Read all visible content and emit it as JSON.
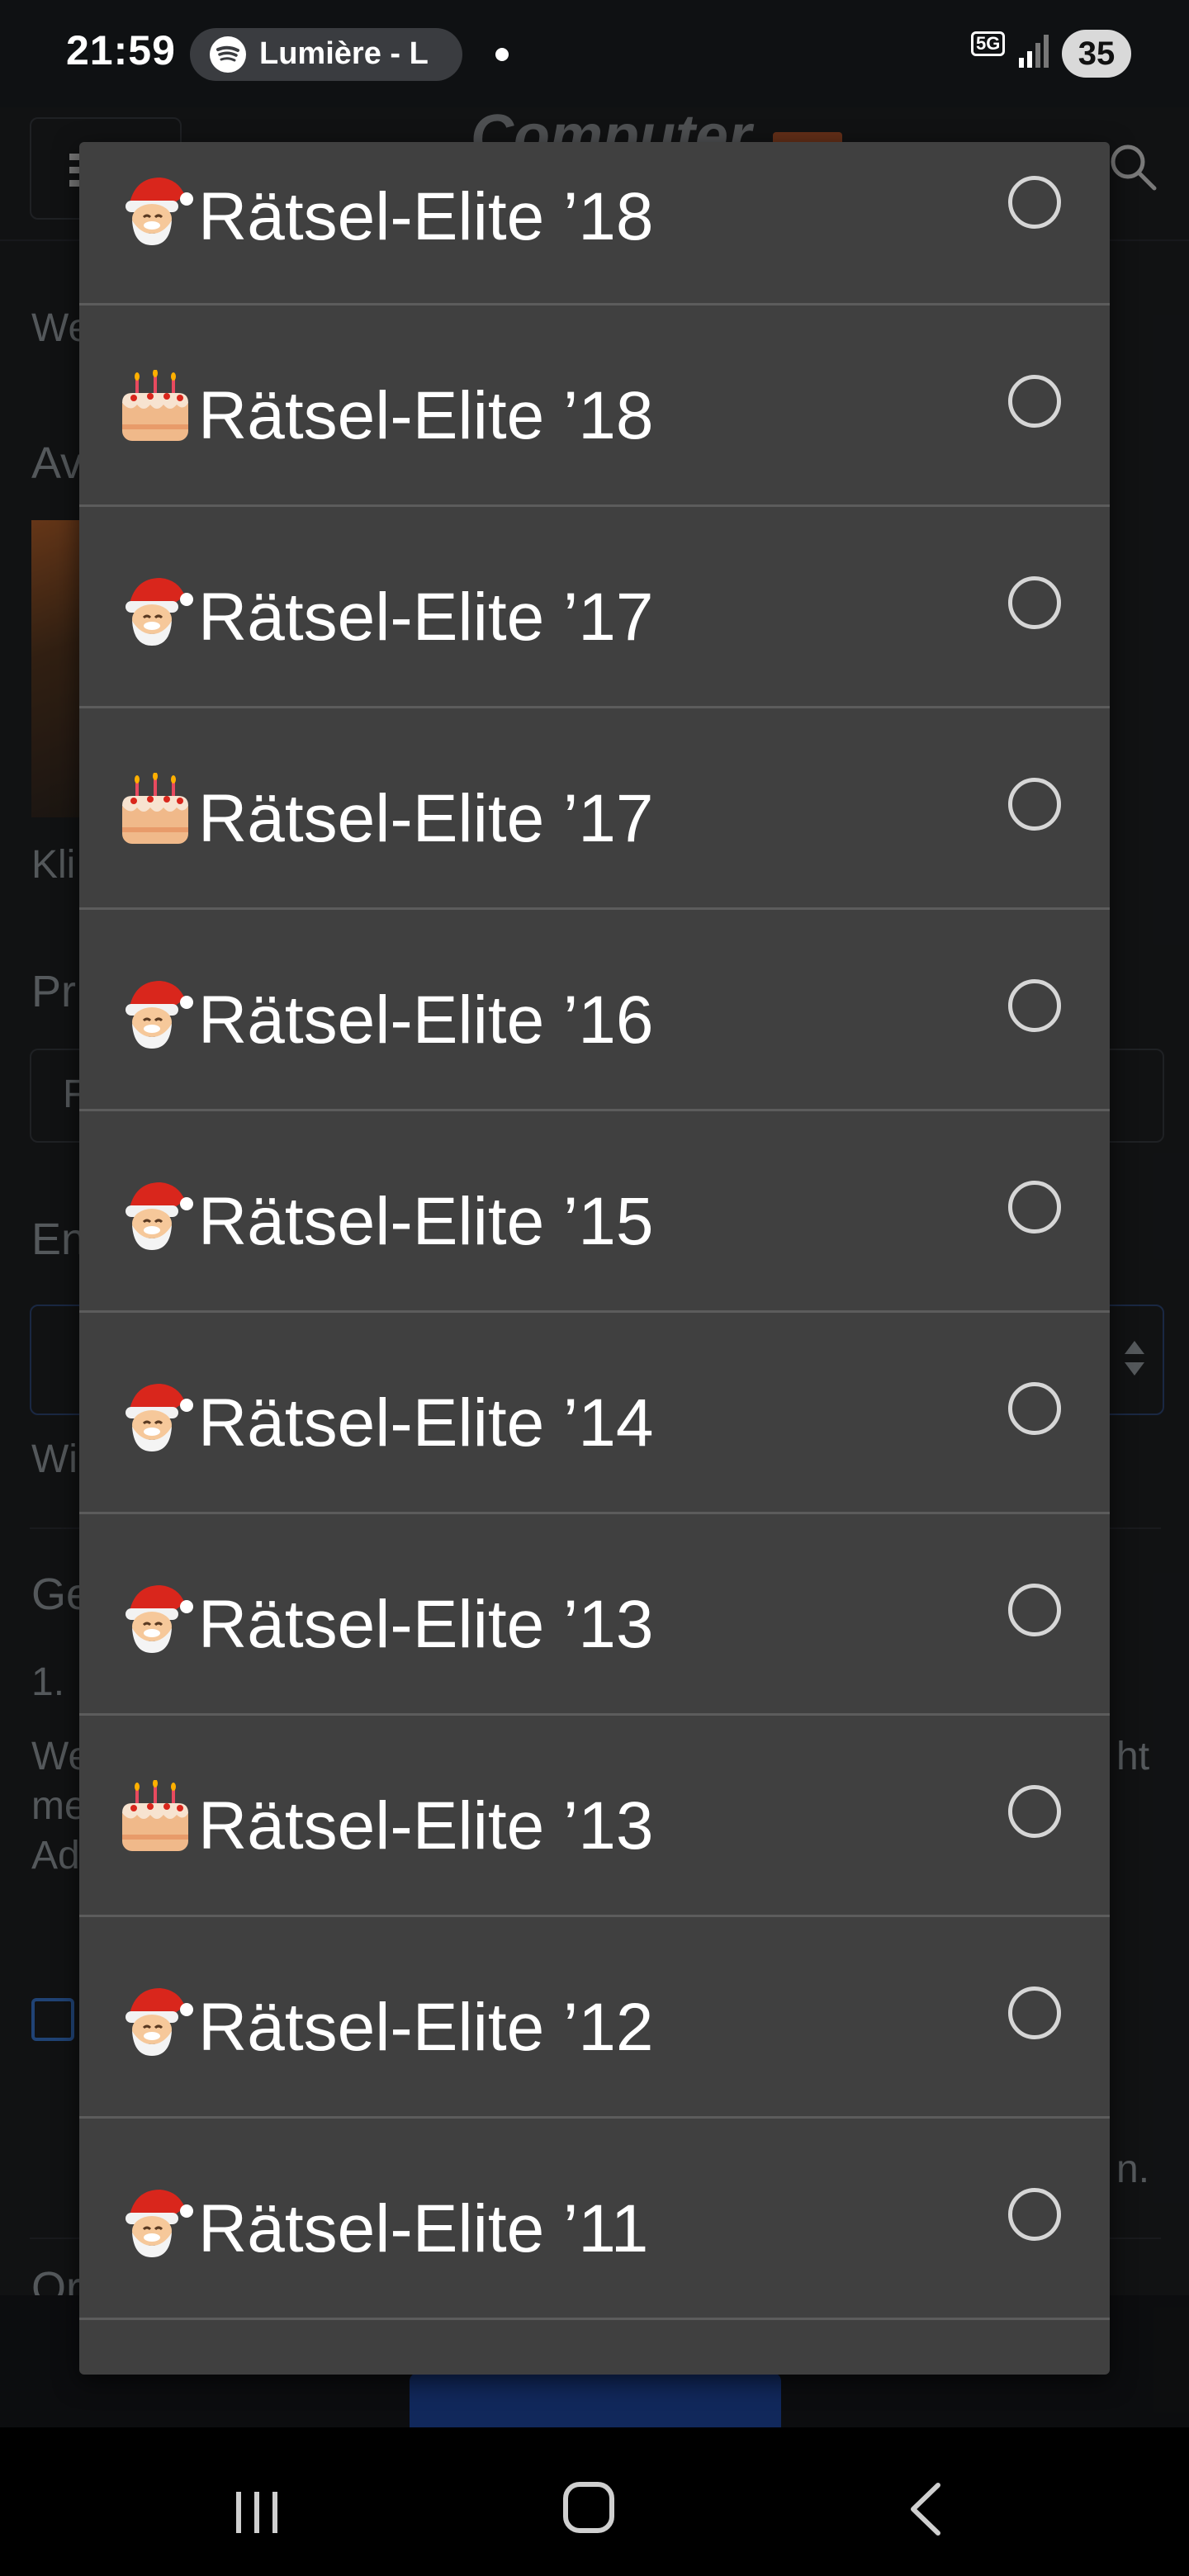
{
  "status_bar": {
    "time": "21:59",
    "media_title": "Lumière - L",
    "network": "5G",
    "battery": "35"
  },
  "page": {
    "logo_text": "Computer",
    "bg_snippets": [
      "We",
      "Av",
      "Kli",
      "Pr",
      "F",
      "En",
      "Wi",
      "Ge",
      "1.",
      "We",
      "me",
      "Ad",
      "ht",
      "n.",
      "Or"
    ]
  },
  "dialog": {
    "options": [
      {
        "icon": "santa-icon",
        "label": "Rätsel-Elite ’18",
        "selected": false
      },
      {
        "icon": "birthday-cake-icon",
        "label": "Rätsel-Elite ’18",
        "selected": false
      },
      {
        "icon": "santa-icon",
        "label": "Rätsel-Elite ’17",
        "selected": false
      },
      {
        "icon": "birthday-cake-icon",
        "label": "Rätsel-Elite ’17",
        "selected": false
      },
      {
        "icon": "santa-icon",
        "label": "Rätsel-Elite ’16",
        "selected": false
      },
      {
        "icon": "santa-icon",
        "label": "Rätsel-Elite ’15",
        "selected": false
      },
      {
        "icon": "santa-icon",
        "label": "Rätsel-Elite ’14",
        "selected": false
      },
      {
        "icon": "santa-icon",
        "label": "Rätsel-Elite ’13",
        "selected": false
      },
      {
        "icon": "birthday-cake-icon",
        "label": "Rätsel-Elite ’13",
        "selected": false
      },
      {
        "icon": "santa-icon",
        "label": "Rätsel-Elite ’12",
        "selected": false
      },
      {
        "icon": "santa-icon",
        "label": "Rätsel-Elite ’11",
        "selected": false
      }
    ]
  }
}
